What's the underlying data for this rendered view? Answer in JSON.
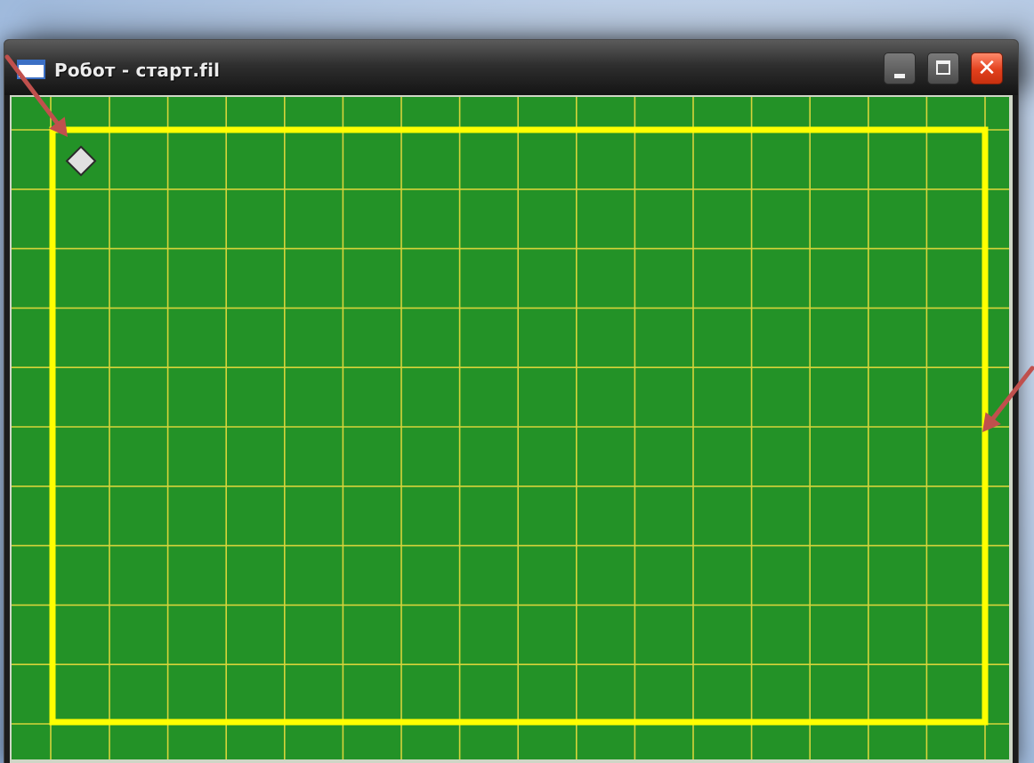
{
  "window": {
    "title": "Робот - старт.fil",
    "app_icon": "window-icon",
    "controls": {
      "minimize_icon": "minimize-icon",
      "maximize_icon": "maximize-icon",
      "close_icon": "close-icon",
      "close_glyph": "✕"
    }
  },
  "field": {
    "background_color": "#239227",
    "grid_line_color": "#d6d43a",
    "wall_color": "#ffff00",
    "robot_color": "#e0e0e0",
    "robot_icon": "robot-diamond-icon"
  },
  "annotations": {
    "arrow_color": "#c0504d",
    "arrow_icon": "arrow-icon"
  }
}
